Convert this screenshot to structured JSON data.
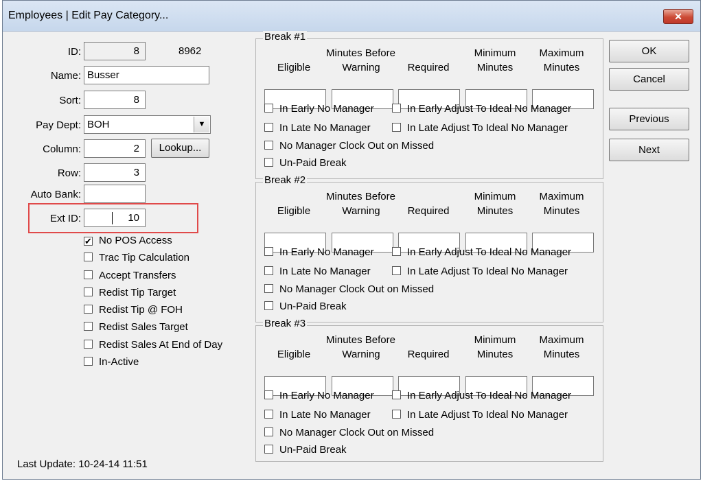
{
  "window": {
    "title": "Employees | Edit Pay Category...",
    "close_glyph": "✕"
  },
  "form": {
    "id_label": "ID:",
    "id_value": "8",
    "id_extra": "8962",
    "name_label": "Name:",
    "name_value": "Busser",
    "sort_label": "Sort:",
    "sort_value": "8",
    "paydept_label": "Pay Dept:",
    "paydept_value": "BOH",
    "column_label": "Column:",
    "column_value": "2",
    "lookup_label": "Lookup...",
    "row_label": "Row:",
    "row_value": "3",
    "autobank_label": "Auto Bank:",
    "autobank_value": "",
    "extid_label": "Ext ID:",
    "extid_value": "10"
  },
  "options": [
    {
      "label": "No POS Access",
      "checked": true
    },
    {
      "label": "Trac Tip Calculation",
      "checked": false
    },
    {
      "label": "Accept Transfers",
      "checked": false
    },
    {
      "label": "Redist Tip Target",
      "checked": false
    },
    {
      "label": "Redist Tip @ FOH",
      "checked": false
    },
    {
      "label": "Redist Sales Target",
      "checked": false
    },
    {
      "label": "Redist Sales At End of Day",
      "checked": false
    },
    {
      "label": "In-Active",
      "checked": false
    }
  ],
  "columns": {
    "eligible": "Eligible",
    "minutes_before": "Minutes Before",
    "warning": "Warning",
    "required": "Required",
    "minimum": "Minimum",
    "maximum": "Maximum",
    "minutes": "Minutes"
  },
  "breaks": [
    {
      "title": "Break #1"
    },
    {
      "title": "Break #2"
    },
    {
      "title": "Break #3"
    }
  ],
  "break_checks": {
    "in_early_no_manager": "In Early No Manager",
    "in_early_adjust": "In Early Adjust To Ideal No Manager",
    "in_late_no_manager": "In Late No Manager",
    "in_late_adjust": "In Late Adjust To Ideal No Manager",
    "no_manager_clock_out": "No Manager Clock Out on Missed",
    "unpaid_break": "Un-Paid Break"
  },
  "buttons": {
    "ok": "OK",
    "cancel": "Cancel",
    "previous": "Previous",
    "next": "Next"
  },
  "footer": {
    "last_update_label": "Last Update:",
    "last_update_value": "10-24-14 11:51"
  },
  "colors": {
    "highlight_box": "#e04a4a",
    "title_bar": "#c6d7ec",
    "dialog_bg": "#f0f0f0"
  }
}
